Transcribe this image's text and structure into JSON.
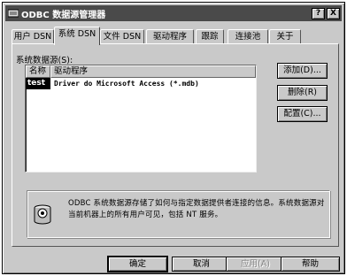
{
  "window": {
    "title": "ODBC 数据源管理器",
    "help_button": "?",
    "close_button": "X"
  },
  "tabs": [
    {
      "label": "用户 DSN",
      "active": false
    },
    {
      "label": "系统 DSN",
      "active": true
    },
    {
      "label": "文件 DSN",
      "active": false
    },
    {
      "label": "驱动程序",
      "active": false
    },
    {
      "label": "跟踪",
      "active": false
    },
    {
      "label": "连接池",
      "active": false
    },
    {
      "label": "关于",
      "active": false
    }
  ],
  "system_dsn": {
    "section_label": "系统数据源(S):",
    "columns": {
      "name": "名称",
      "driver": "驱动程序"
    },
    "rows": [
      {
        "name": "test",
        "driver": "Driver do Microsoft Access (*.mdb)",
        "selected": true
      }
    ]
  },
  "side_buttons": {
    "add": "添加(D)...",
    "remove": "删除(R)",
    "configure": "配置(C)..."
  },
  "info": {
    "icon": "odbc-datasource-icon",
    "text": "ODBC 系统数据源存储了如何与指定数据提供者连接的信息。系统数据源对当前机器上的所有用户可见，包括 NT 服务。"
  },
  "bottom_buttons": {
    "ok": "确定",
    "cancel": "取消",
    "apply": "应用(A)",
    "help": "帮助"
  }
}
